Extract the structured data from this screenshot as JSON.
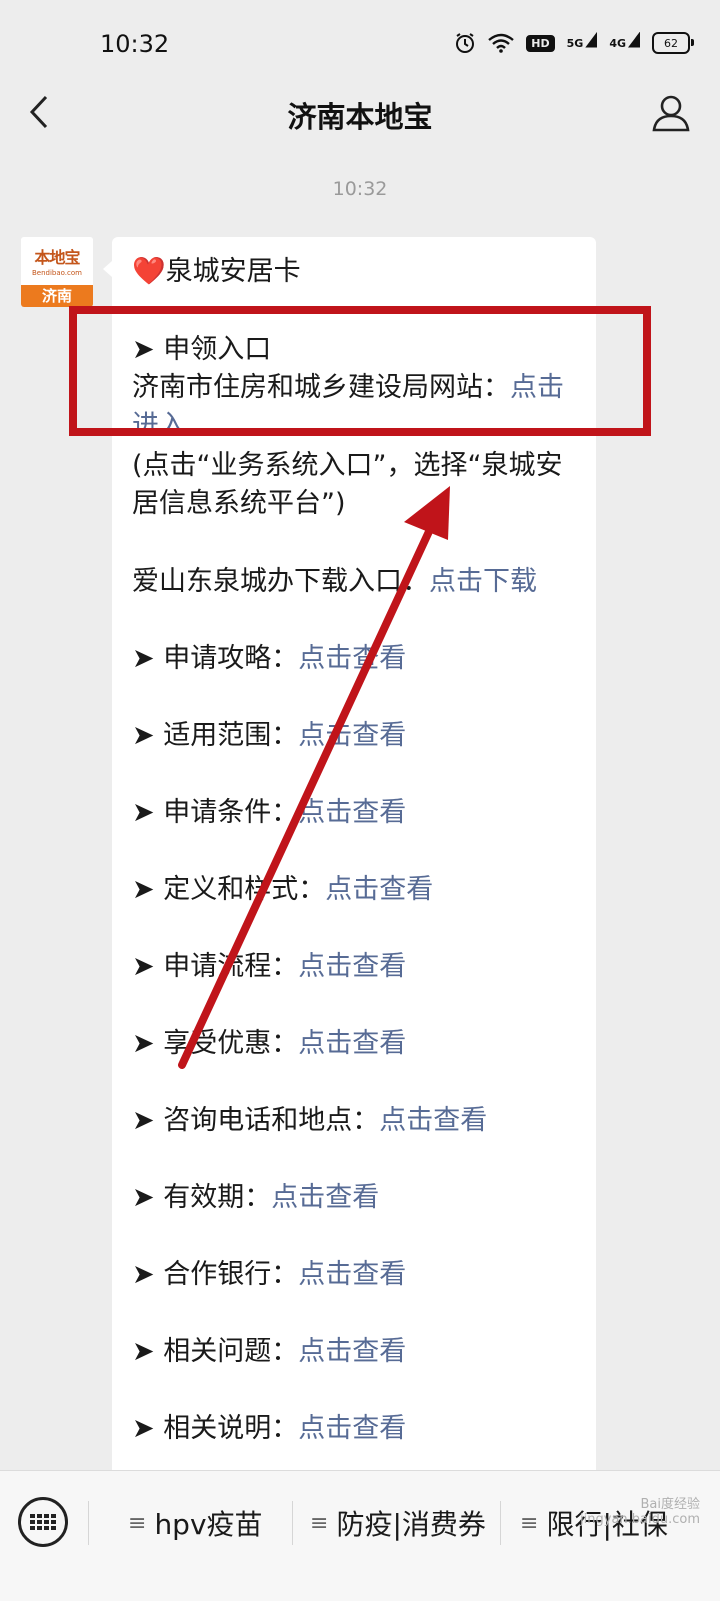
{
  "status_bar": {
    "time": "10:32",
    "hd_label": "HD",
    "net1": "5G",
    "net2": "4G",
    "battery": "62"
  },
  "nav": {
    "title": "济南本地宝"
  },
  "chat": {
    "timestamp": "10:32",
    "avatar": {
      "logo": "本地宝",
      "sub": "Bendibao.com",
      "city": "济南"
    },
    "heart": "❤️",
    "title": "泉城安居卡",
    "entry_heading": "➤ 申领入口",
    "site_line_text": "济南市住房和城乡建设局网站：",
    "site_line_link": "点击进入",
    "note": "(点击“业务系统入口”，选择“泉城安居信息系统平台”)",
    "app_text": "爱山东泉城办下载入口：",
    "app_link": "点击下载",
    "items": [
      {
        "label": "➤ 申请攻略：",
        "link": "点击查看"
      },
      {
        "label": "➤ 适用范围：",
        "link": "点击查看"
      },
      {
        "label": "➤ 申请条件：",
        "link": "点击查看"
      },
      {
        "label": "➤ 定义和样式：",
        "link": "点击查看"
      },
      {
        "label": "➤ 申请流程：",
        "link": "点击查看"
      },
      {
        "label": "➤ 享受优惠：",
        "link": "点击查看"
      },
      {
        "label": "➤ 咨询电话和地点：",
        "link": "点击查看"
      },
      {
        "label": "➤ 有效期：",
        "link": "点击查看"
      },
      {
        "label": "➤ 合作银行：",
        "link": "点击查看"
      },
      {
        "label": "➤ 相关问题：",
        "link": "点击查看"
      },
      {
        "label": "➤ 相关说明：",
        "link": "点击查看"
      }
    ]
  },
  "bottom_menu": [
    {
      "label": "hpv疫苗"
    },
    {
      "label": "防疫|消费券"
    },
    {
      "label": "限行|社保"
    }
  ],
  "watermark": {
    "line1": "Bai度经验",
    "line2": "jingyan.baidu.com"
  },
  "colors": {
    "link": "#576b95",
    "annotation": "#c0141a",
    "avatar_orange": "#ec7a1e"
  }
}
